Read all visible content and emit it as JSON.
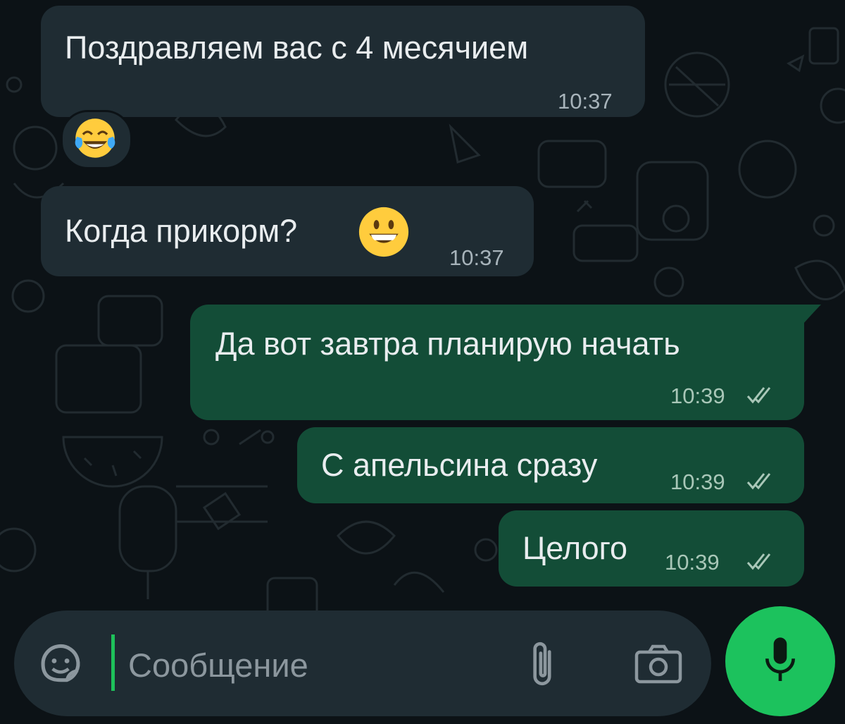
{
  "messages": [
    {
      "direction": "incoming",
      "text": "Поздравляем вас с 4 месячием",
      "time": "10:37",
      "reaction": "tears-of-joy-emoji"
    },
    {
      "direction": "incoming",
      "text": "Когда прикорм?",
      "time": "10:37",
      "emoji": "grinning-face-emoji"
    },
    {
      "direction": "outgoing",
      "text": "Да вот завтра планирую начать",
      "time": "10:39",
      "status": "read"
    },
    {
      "direction": "outgoing",
      "text": "С апельсина сразу",
      "time": "10:39",
      "status": "read"
    },
    {
      "direction": "outgoing",
      "text": "Целого",
      "time": "10:39",
      "status": "read"
    }
  ],
  "composer": {
    "placeholder": "Сообщение",
    "value": "",
    "icons": [
      "sticker-icon",
      "attach-icon",
      "camera-icon",
      "microphone-icon"
    ]
  },
  "colors": {
    "background": "#0c1216",
    "incoming_bubble": "#1f2c33",
    "outgoing_bubble": "#134d37",
    "accent": "#1cc25d",
    "text": "#e9edef",
    "meta_text": "#a7b3ba"
  }
}
